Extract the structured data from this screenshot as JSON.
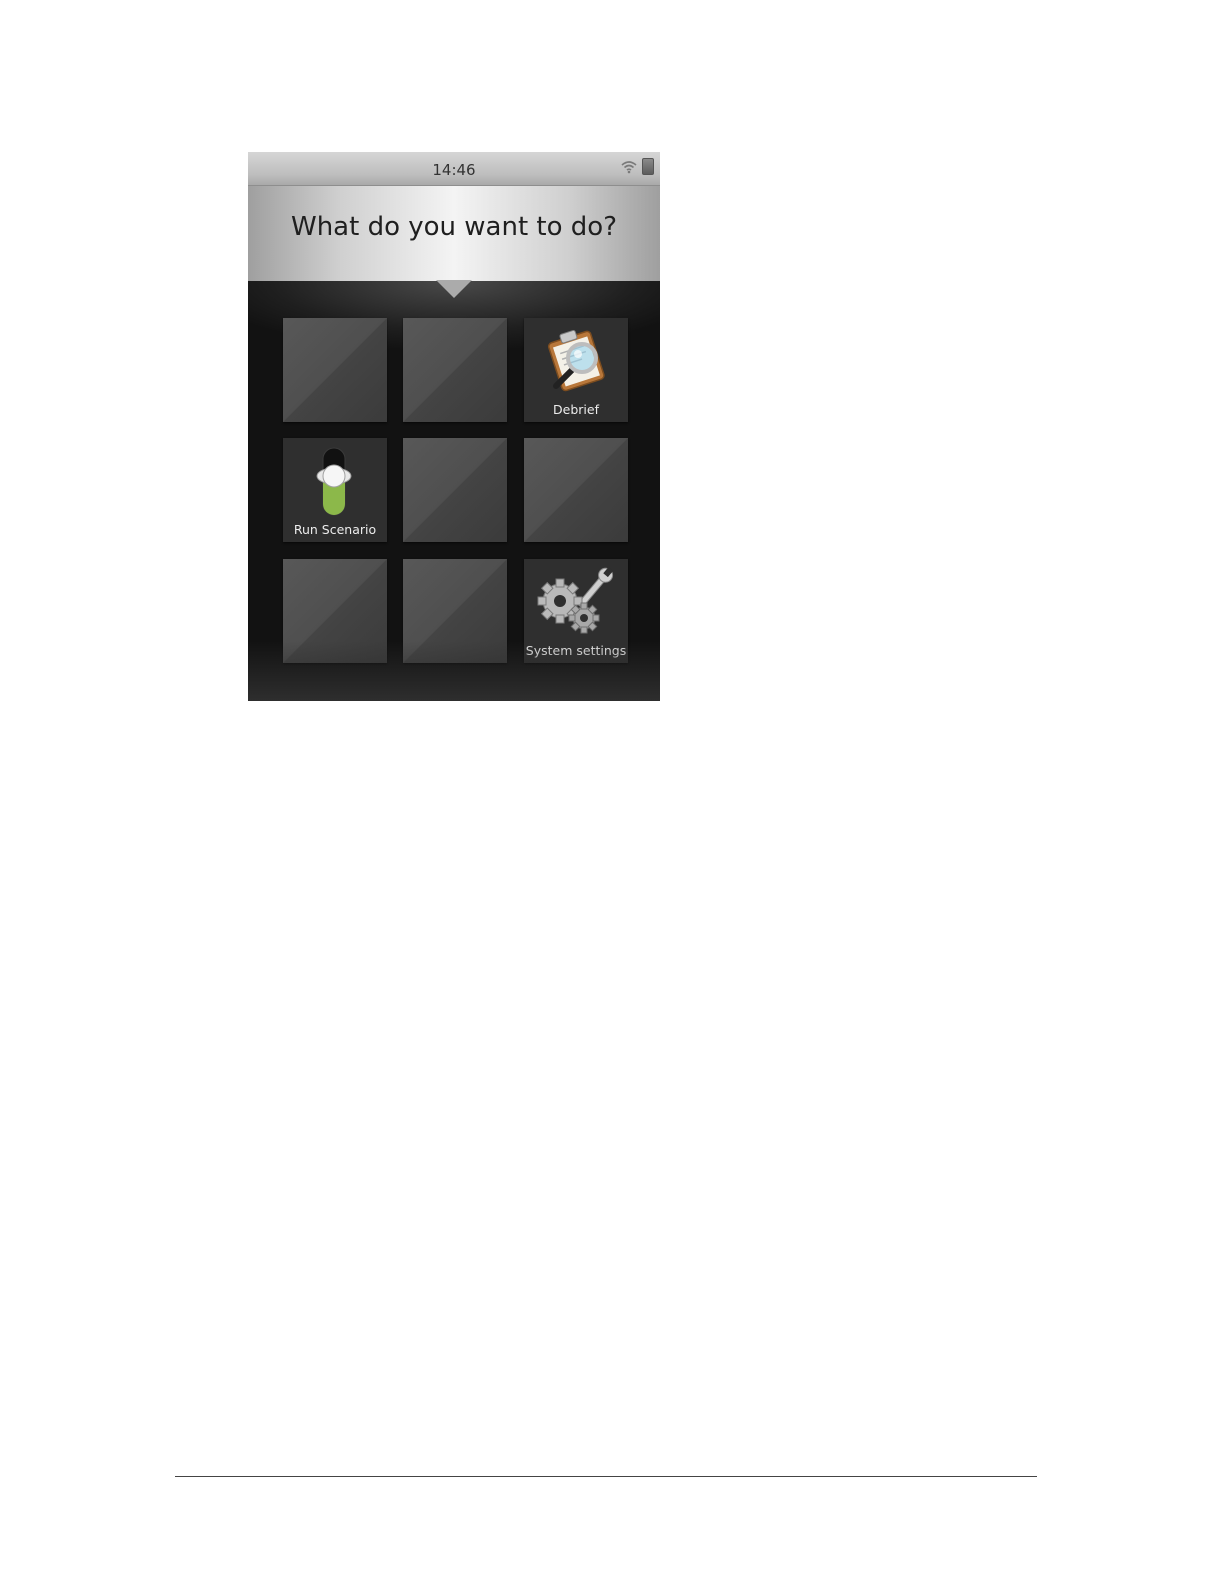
{
  "status_bar": {
    "time": "14:46",
    "icons": [
      "wifi-icon",
      "battery-icon"
    ]
  },
  "header": {
    "title": "What do you want to do?"
  },
  "tiles": [
    {
      "label": "",
      "icon": ""
    },
    {
      "label": "",
      "icon": ""
    },
    {
      "label": "Debrief",
      "icon": "clipboard-magnifier-icon"
    },
    {
      "label": "Run Scenario",
      "icon": "slider-switch-icon"
    },
    {
      "label": "",
      "icon": ""
    },
    {
      "label": "",
      "icon": ""
    },
    {
      "label": "",
      "icon": ""
    },
    {
      "label": "",
      "icon": ""
    },
    {
      "label": "System settings",
      "icon": "gears-wrench-icon"
    }
  ],
  "colors": {
    "screen_bg": "#1a1a1a",
    "tile": "#4f4f4f",
    "slider_green": "#8cb84a",
    "clipboard_brown": "#b8773a"
  }
}
